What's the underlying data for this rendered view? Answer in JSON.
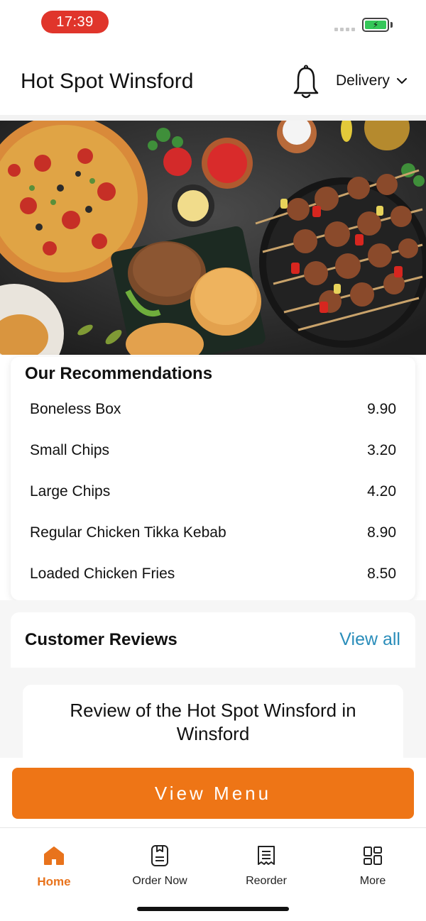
{
  "status_bar": {
    "time": "17:39",
    "battery_icon": "battery-charging-icon",
    "battery_color": "#34c759",
    "time_pill_color": "#e0352b"
  },
  "header": {
    "title": "Hot Spot Winsford",
    "bell_icon": "bell-icon",
    "order_mode": "Delivery"
  },
  "hero": {
    "image": "food-banner-pizza-burgers-kebabs"
  },
  "recommendations": {
    "title": "Our Recommendations",
    "items": [
      {
        "name": "Boneless Box",
        "price": "9.90"
      },
      {
        "name": "Small Chips",
        "price": "3.20"
      },
      {
        "name": "Large Chips",
        "price": "4.20"
      },
      {
        "name": "Regular Chicken Tikka Kebab",
        "price": "8.90"
      },
      {
        "name": "Loaded Chicken Fries",
        "price": "8.50"
      }
    ]
  },
  "reviews": {
    "title": "Customer Reviews",
    "view_all": "View all",
    "view_all_color": "#2a8dba",
    "review_heading": "Review of the Hot Spot Winsford in Winsford"
  },
  "cta": {
    "label": "View Menu",
    "color": "#ee7516"
  },
  "tabbar": {
    "accent": "#e8731c",
    "tabs": [
      {
        "label": "Home",
        "icon": "home-icon",
        "active": true
      },
      {
        "label": "Order Now",
        "icon": "order-now-icon",
        "active": false
      },
      {
        "label": "Reorder",
        "icon": "receipt-icon",
        "active": false
      },
      {
        "label": "More",
        "icon": "grid-icon",
        "active": false
      }
    ]
  }
}
